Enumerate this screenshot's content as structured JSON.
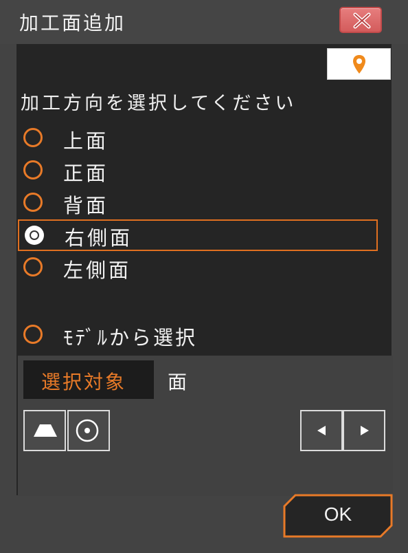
{
  "dialog": {
    "title": "加工面追加",
    "close_icon": "close-x-icon",
    "pin_icon": "map-pin-icon",
    "prompt": "加工方向を選択してください"
  },
  "options": [
    {
      "label": "上面",
      "selected": false
    },
    {
      "label": "正面",
      "selected": false
    },
    {
      "label": "背面",
      "selected": false
    },
    {
      "label": "右側面",
      "selected": true
    },
    {
      "label": "左側面",
      "selected": false
    },
    {
      "label": "ﾓﾃﾞﾙから選択",
      "selected": false
    }
  ],
  "selection": {
    "target_label": "選択対象",
    "target_value": "面"
  },
  "tools": [
    "face-select-icon",
    "point-select-icon"
  ],
  "nav": [
    "prev-arrow-icon",
    "next-arrow-icon"
  ],
  "ok_label": "OK",
  "colors": {
    "accent": "#e87a28",
    "background": "#252525",
    "frame": "#434343",
    "close": "#e06b6b"
  }
}
